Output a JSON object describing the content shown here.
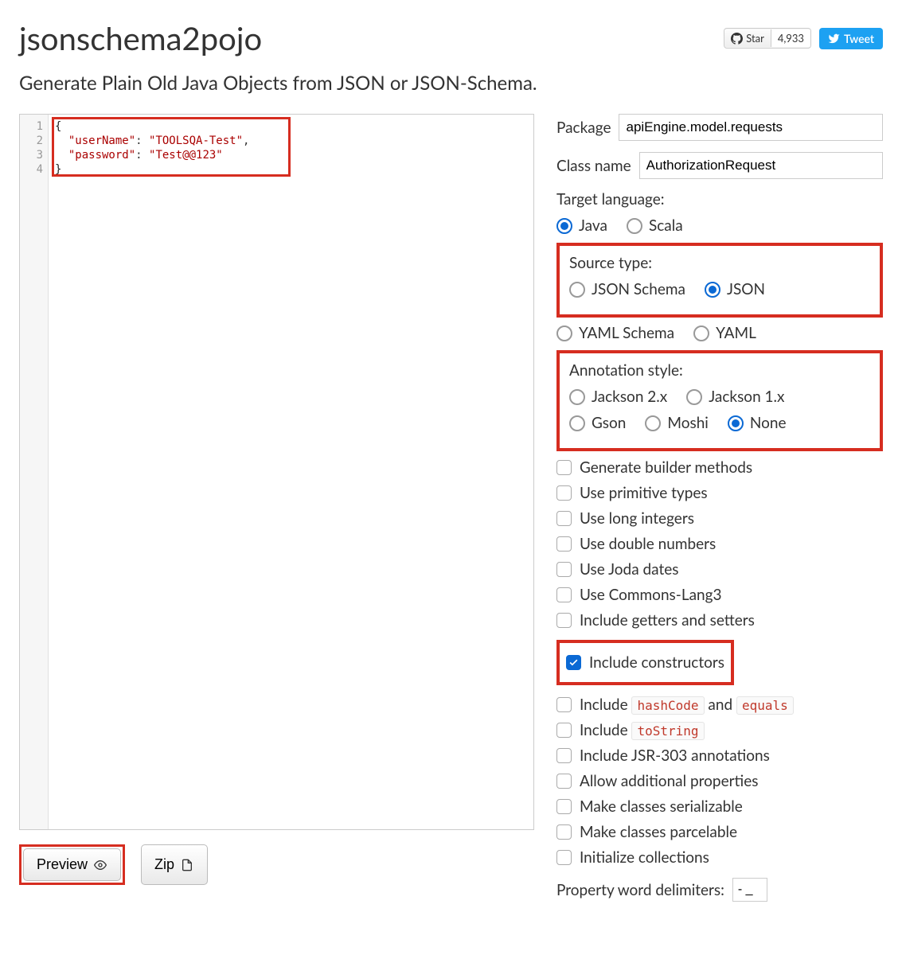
{
  "header": {
    "title": "jsonschema2pojo",
    "star_label": "Star",
    "star_count": "4,933",
    "tweet_label": "Tweet"
  },
  "subtitle": "Generate Plain Old Java Objects from JSON or JSON-Schema.",
  "editor": {
    "line_numbers": [
      "1",
      "2",
      "3",
      "4"
    ],
    "content": "{\n  \"userName\": \"TOOLSQA-Test\",\n  \"password\": \"Test@@123\"\n}"
  },
  "actions": {
    "preview": "Preview",
    "zip": "Zip"
  },
  "form": {
    "package_label": "Package",
    "package_value": "apiEngine.model.requests",
    "class_label": "Class name",
    "class_value": "AuthorizationRequest",
    "target_lang_label": "Target language:",
    "target_lang": [
      {
        "label": "Java",
        "checked": true
      },
      {
        "label": "Scala",
        "checked": false
      }
    ],
    "source_type_label": "Source type:",
    "source_row1": [
      {
        "label": "JSON Schema",
        "checked": false
      },
      {
        "label": "JSON",
        "checked": true
      }
    ],
    "source_row2": [
      {
        "label": "YAML Schema",
        "checked": false
      },
      {
        "label": "YAML",
        "checked": false
      }
    ],
    "annotation_label": "Annotation style:",
    "annotation_row1": [
      {
        "label": "Jackson 2.x",
        "checked": false
      },
      {
        "label": "Jackson 1.x",
        "checked": false
      }
    ],
    "annotation_row2": [
      {
        "label": "Gson",
        "checked": false
      },
      {
        "label": "Moshi",
        "checked": false
      },
      {
        "label": "None",
        "checked": true
      }
    ],
    "checks": {
      "builder": {
        "label": "Generate builder methods",
        "checked": false
      },
      "primitive": {
        "label": "Use primitive types",
        "checked": false
      },
      "longint": {
        "label": "Use long integers",
        "checked": false
      },
      "double": {
        "label": "Use double numbers",
        "checked": false
      },
      "joda": {
        "label": "Use Joda dates",
        "checked": false
      },
      "commons": {
        "label": "Use Commons-Lang3",
        "checked": false
      },
      "getset": {
        "label": "Include getters and setters",
        "checked": false
      },
      "ctors": {
        "label": "Include constructors",
        "checked": true
      },
      "hashcode": {
        "prefix": "Include ",
        "code1": "hashCode",
        "mid": " and ",
        "code2": "equals",
        "checked": false
      },
      "tostring": {
        "prefix": "Include ",
        "code1": "toString",
        "checked": false
      },
      "jsr303": {
        "label": "Include JSR-303 annotations",
        "checked": false
      },
      "additional": {
        "label": "Allow additional properties",
        "checked": false
      },
      "serial": {
        "label": "Make classes serializable",
        "checked": false
      },
      "parcel": {
        "label": "Make classes parcelable",
        "checked": false
      },
      "initcoll": {
        "label": "Initialize collections",
        "checked": false
      }
    },
    "delim_label": "Property word delimiters:",
    "delim_value": "- _"
  }
}
